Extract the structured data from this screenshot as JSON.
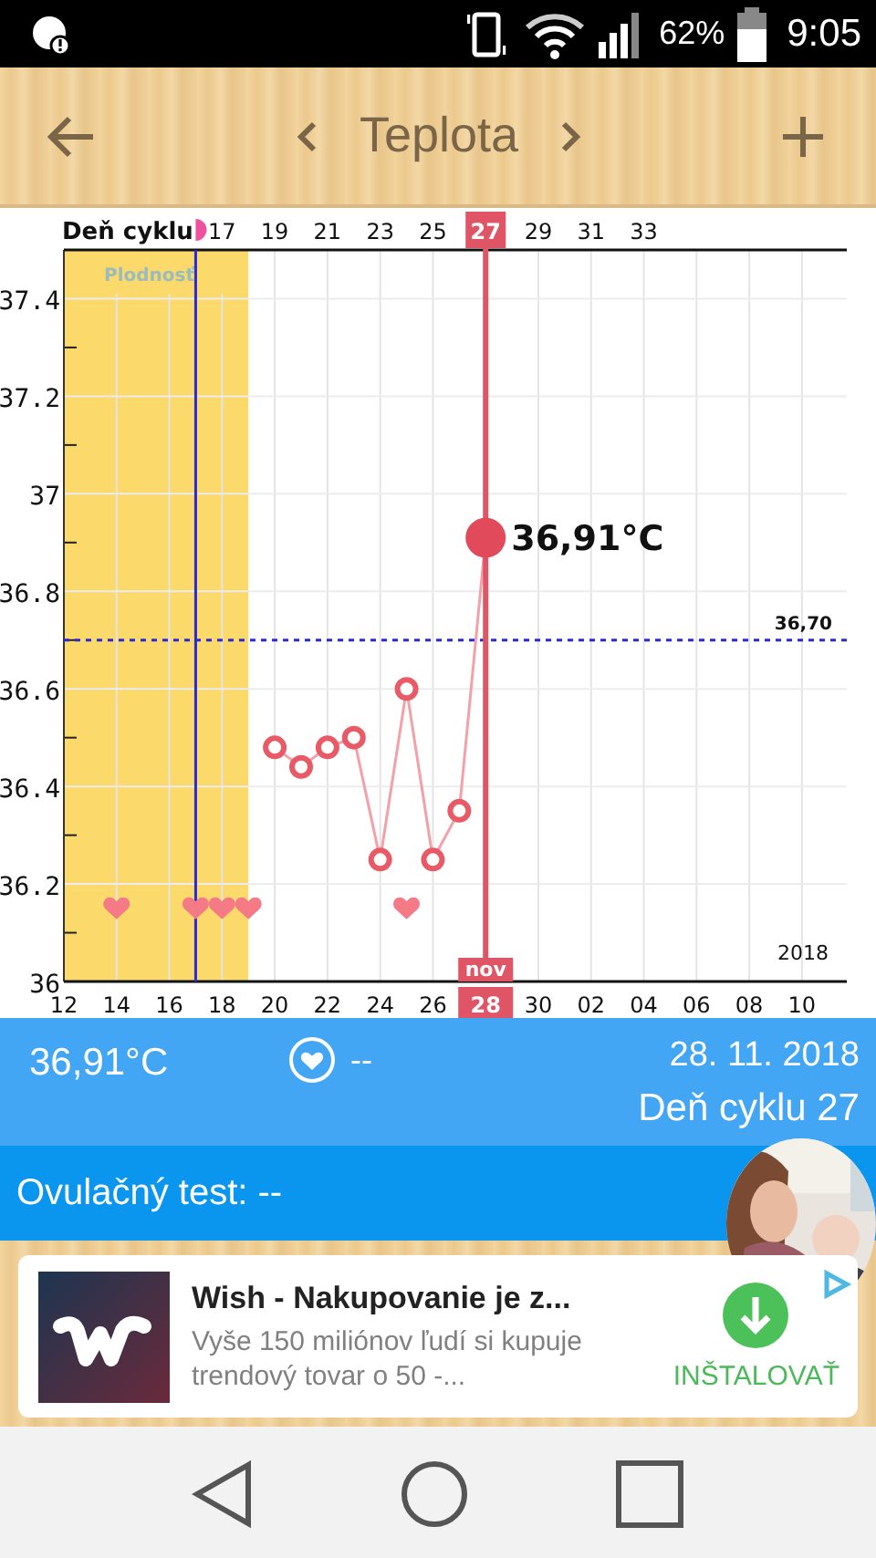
{
  "status_bar": {
    "battery": "62%",
    "time": "9:05"
  },
  "header": {
    "title": "Teplota"
  },
  "cycle_axis": {
    "title": "Deň cyklu",
    "ticks": [
      "17",
      "19",
      "21",
      "23",
      "25",
      "27",
      "29",
      "31",
      "33"
    ]
  },
  "selected_day": {
    "month": "nov"
  },
  "chart_data": {
    "type": "line",
    "categories": [
      "12",
      null,
      "14",
      null,
      "16",
      null,
      "18",
      null,
      "20",
      null,
      "22",
      null,
      "24",
      null,
      "26",
      null,
      "28",
      null,
      "30",
      null,
      "02",
      null,
      "04",
      null,
      "06",
      null,
      "08",
      null,
      "10",
      null
    ],
    "series": [
      {
        "color": "#e85a66",
        "marker": "circle",
        "values": [
          null,
          null,
          null,
          null,
          null,
          null,
          null,
          null,
          36.48,
          36.44,
          36.48,
          36.5,
          36.25,
          36.6,
          36.25,
          36.35,
          36.91,
          null,
          null,
          null,
          null,
          null,
          null,
          null,
          null,
          null,
          null,
          null,
          null,
          null
        ]
      },
      {
        "color": "#f47a86",
        "type": "scatter",
        "values": [
          null,
          null,
          36.15,
          null,
          null,
          36.15,
          36.15,
          36.15,
          null,
          null,
          null,
          null,
          null,
          36.15,
          null,
          null,
          null,
          null,
          null,
          null,
          null,
          null,
          null,
          null,
          null,
          null,
          null,
          null,
          null,
          null
        ]
      }
    ],
    "ylim": [
      36,
      37.5
    ],
    "grid": true,
    "yticks": [
      36,
      36.2,
      36.4,
      36.6,
      36.8,
      37,
      37.2,
      37.4
    ],
    "ref_lines": [
      {
        "axis": "y",
        "value": 36.7,
        "label": "36,70"
      }
    ],
    "annotations": [
      {
        "text": "36,91°C",
        "x": "28",
        "y": 36.91
      },
      {
        "text": "2018"
      }
    ]
  },
  "fertile_window": {
    "label": "Plodnosť"
  },
  "summary": {
    "temperature": "36,91°C",
    "intercourse": "--",
    "date": "28. 11. 2018",
    "cycle_day": "Deň cyklu 27"
  },
  "ovulation_test": {
    "label": "Ovulačný test: --"
  },
  "ad": {
    "title": "Wish - Nakupovanie je z...",
    "body": "Vyše 150 miliónov ľudí si kupuje trendový tovar o 50 -...",
    "action": "INŠTALOVAŤ"
  }
}
